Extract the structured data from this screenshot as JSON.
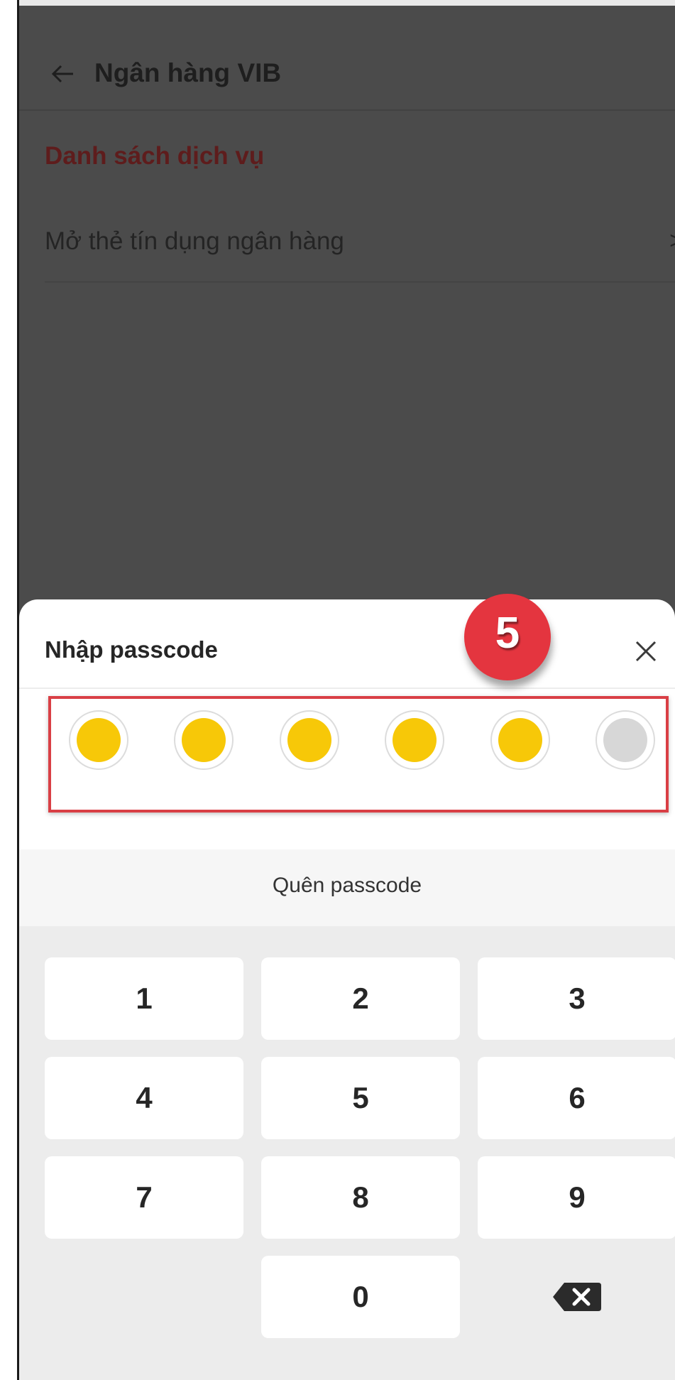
{
  "header": {
    "title": "Ngân hàng VIB",
    "back_icon": "arrow-left-icon"
  },
  "section": {
    "title": "Danh sách dịch vụ"
  },
  "services": [
    {
      "label": "Mở thẻ tín dụng ngân hàng",
      "chevron": ">"
    }
  ],
  "sheet": {
    "title": "Nhập passcode",
    "close_icon": "close-icon",
    "step_badge": "5",
    "forgot_label": "Quên passcode",
    "digits_entered": 5,
    "digits_total": 6,
    "keys": [
      "1",
      "2",
      "3",
      "4",
      "5",
      "6",
      "7",
      "8",
      "9",
      "0"
    ],
    "backspace_icon": "backspace-icon"
  },
  "colors": {
    "dim_overlay": "#4b4b4b",
    "dot_filled": "#f7c808",
    "dot_empty": "#d7d7d7",
    "highlight": "#d93f45",
    "badge": "#e4353f"
  }
}
